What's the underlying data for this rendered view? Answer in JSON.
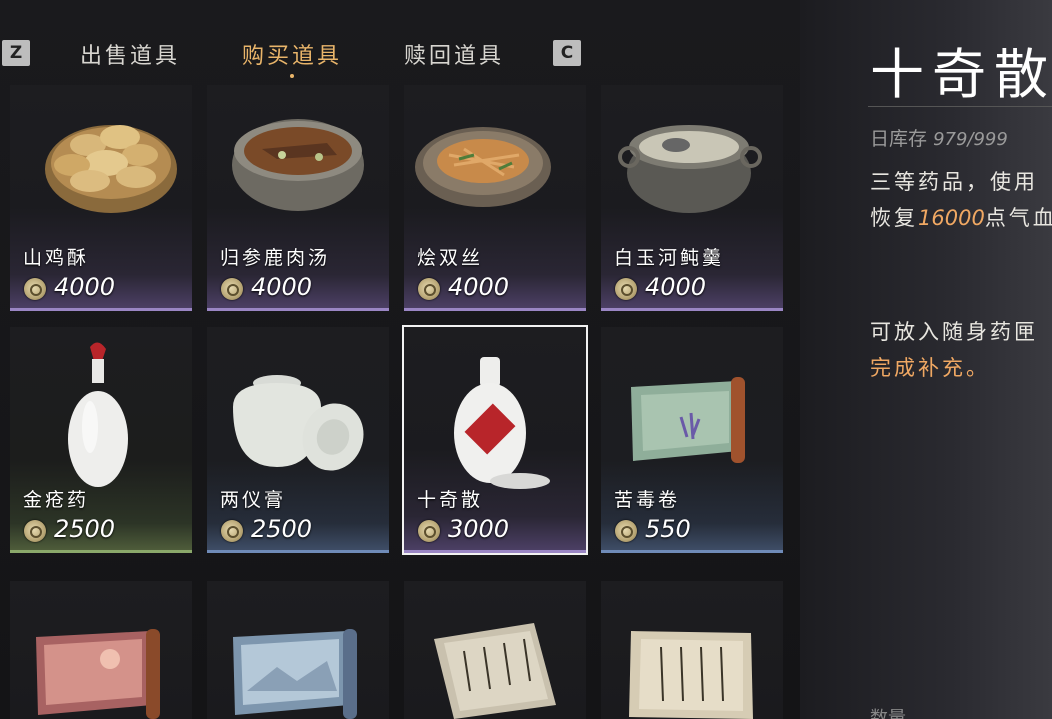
{
  "tabs": {
    "left_key": "Z",
    "right_key": "C",
    "items": [
      {
        "label": "出售道具",
        "active": false
      },
      {
        "label": "购买道具",
        "active": true
      },
      {
        "label": "赎回道具",
        "active": false
      }
    ]
  },
  "items": [
    {
      "name": "山鸡酥",
      "price": "4000",
      "currency_icon": "coin-icon"
    },
    {
      "name": "归参鹿肉汤",
      "price": "4000",
      "currency_icon": "coin-icon"
    },
    {
      "name": "烩双丝",
      "price": "4000",
      "currency_icon": "coin-icon"
    },
    {
      "name": "白玉河鲀羹",
      "price": "4000",
      "currency_icon": "coin-icon"
    },
    {
      "name": "金疮药",
      "price": "2500",
      "currency_icon": "coin-icon"
    },
    {
      "name": "两仪膏",
      "price": "2500",
      "currency_icon": "coin-icon"
    },
    {
      "name": "十奇散",
      "price": "3000",
      "currency_icon": "coin-icon",
      "selected": true
    },
    {
      "name": "苦毒卷",
      "price": "550",
      "currency_icon": "coin-icon"
    },
    {
      "name": "",
      "price": ""
    },
    {
      "name": "",
      "price": ""
    },
    {
      "name": "",
      "price": ""
    },
    {
      "name": "",
      "price": ""
    }
  ],
  "detail": {
    "title": "十奇散",
    "stock_label": "日库存",
    "stock_value": "979/999",
    "desc_line1": "三等药品，使用",
    "desc_line2_pre": "恢复",
    "desc_line2_value": "16000",
    "desc_line2_post": "点气血",
    "desc_line3": "可放入随身药匣",
    "desc_line4": "完成补充。",
    "quantity_label": "数量"
  },
  "colors": {
    "accent": "#e9b56a",
    "highlight": "#f0a863",
    "tier_purple": "#9a86c4",
    "tier_green": "#8aa86a",
    "tier_blue": "#6f8bb8"
  }
}
